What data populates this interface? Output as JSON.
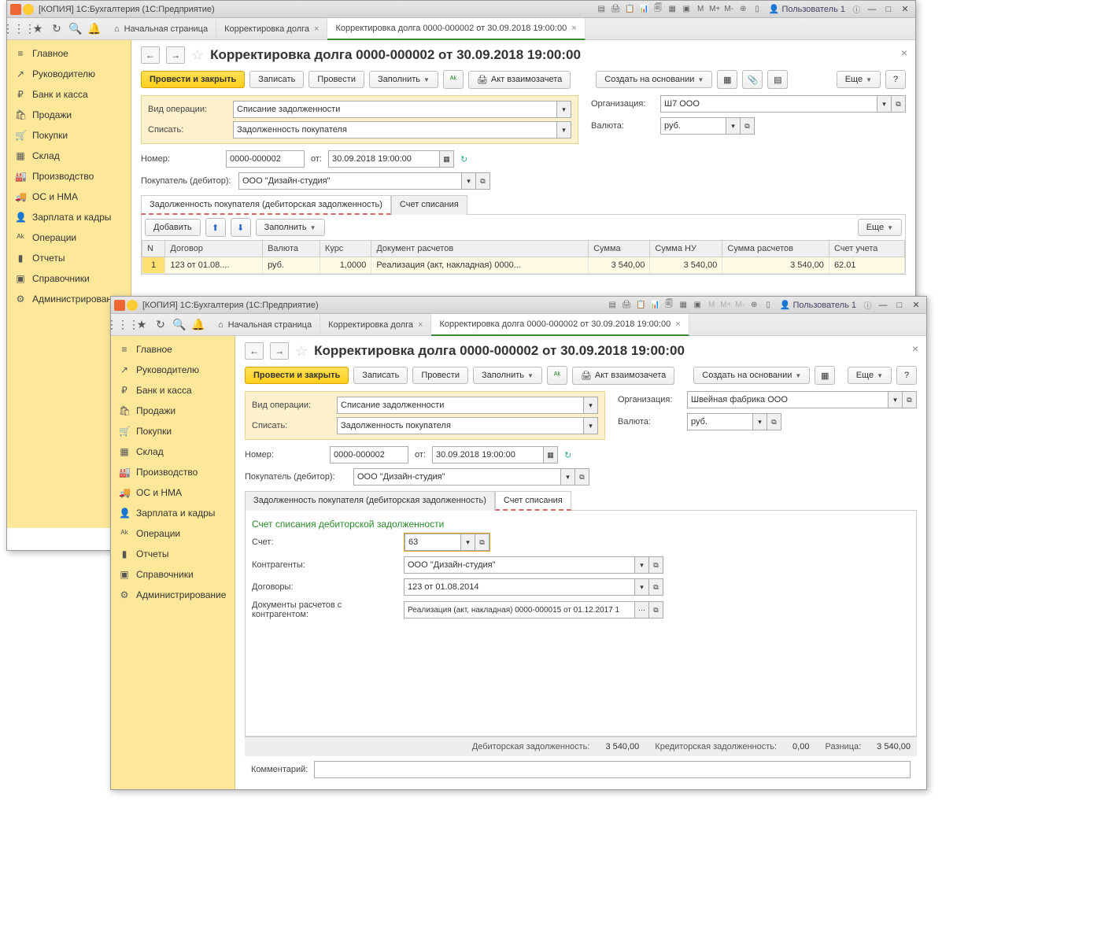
{
  "win1": {
    "title": "[КОПИЯ] 1С:Бухгалтерия  (1С:Предприятие)",
    "user": "Пользователь 1",
    "tb_letters": [
      "М",
      "М+",
      "М-"
    ],
    "tabs": [
      {
        "label": "Начальная страница"
      },
      {
        "label": "Корректировка долга"
      },
      {
        "label": "Корректировка долга 0000-000002 от 30.09.2018 19:00:00"
      }
    ],
    "sidebar": [
      {
        "icon": "≡",
        "label": "Главное"
      },
      {
        "icon": "↗",
        "label": "Руководителю"
      },
      {
        "icon": "₽",
        "label": "Банк и касса"
      },
      {
        "icon": "🛍",
        "label": "Продажи"
      },
      {
        "icon": "🛒",
        "label": "Покупки"
      },
      {
        "icon": "▦",
        "label": "Склад"
      },
      {
        "icon": "🏭",
        "label": "Производство"
      },
      {
        "icon": "🚚",
        "label": "ОС и НМА"
      },
      {
        "icon": "👤",
        "label": "Зарплата и кадры"
      },
      {
        "icon": "ᴬᵏ",
        "label": "Операции"
      },
      {
        "icon": "▮",
        "label": "Отчеты"
      },
      {
        "icon": "▣",
        "label": "Справочники"
      },
      {
        "icon": "⚙",
        "label": "Администрирование"
      }
    ],
    "doc_title": "Корректировка долга 0000-000002 от 30.09.2018 19:00:00",
    "buttons": {
      "post_close": "Провести и закрыть",
      "write": "Записать",
      "post": "Провести",
      "fill": "Заполнить",
      "act": "Акт взаимозачета",
      "create_based": "Создать на основании",
      "more": "Еще"
    },
    "fields": {
      "op_type_lbl": "Вид операции:",
      "op_type": "Списание задолженности",
      "writeoff_lbl": "Списать:",
      "writeoff": "Задолженность покупателя",
      "org_lbl": "Организация:",
      "org": "Ш7 ООО",
      "currency_lbl": "Валюта:",
      "currency": "руб.",
      "num_lbl": "Номер:",
      "num": "0000-000002",
      "date_lbl": "от:",
      "date": "30.09.2018 19:00:00",
      "buyer_lbl": "Покупатель (дебитор):",
      "buyer": "ООО \"Дизайн-студия\""
    },
    "subtabs": {
      "tab1": "Задолженность покупателя (дебиторская задолженность)",
      "tab2": "Счет списания"
    },
    "tbl_toolbar": {
      "add": "Добавить",
      "fill": "Заполнить",
      "more": "Еще"
    },
    "table": {
      "headers": [
        "N",
        "Договор",
        "Валюта",
        "Курс",
        "Документ расчетов",
        "Сумма",
        "Сумма НУ",
        "Сумма расчетов",
        "Счет учета"
      ],
      "row": {
        "n": "1",
        "contract": "123 от 01.08....",
        "currency": "руб.",
        "rate": "1,0000",
        "doc": "Реализация (акт, накладная) 0000...",
        "sum": "3 540,00",
        "sum_nu": "3 540,00",
        "sum_calc": "3 540,00",
        "account": "62.01"
      }
    }
  },
  "win2": {
    "title": "[КОПИЯ] 1С:Бухгалтерия  (1С:Предприятие)",
    "user": "Пользователь 1",
    "tb_letters": [
      "М",
      "М+",
      "М-"
    ],
    "tabs": [
      {
        "label": "Начальная страница"
      },
      {
        "label": "Корректировка долга"
      },
      {
        "label": "Корректировка долга 0000-000002 от 30.09.2018 19:00:00"
      }
    ],
    "doc_title": "Корректировка долга 0000-000002 от 30.09.2018 19:00:00",
    "fields": {
      "op_type": "Списание задолженности",
      "writeoff": "Задолженность покупателя",
      "org": "Швейная фабрика ООО",
      "currency": "руб.",
      "num": "0000-000002",
      "date": "30.09.2018 19:00:00",
      "buyer": "ООО \"Дизайн-студия\""
    },
    "section_title": "Счет списания дебиторской задолженности",
    "writeoff_fields": {
      "account_lbl": "Счет:",
      "account": "63",
      "contr_lbl": "Контрагенты:",
      "contr": "ООО \"Дизайн-студия\"",
      "contracts_lbl": "Договоры:",
      "contracts": "123 от 01.08.2014",
      "docs_lbl": "Документы расчетов с контрагентом:",
      "docs": "Реализация (акт, накладная) 0000-000015 от 01.12.2017 1"
    },
    "footer": {
      "deb_lbl": "Дебиторская задолженность:",
      "deb": "3 540,00",
      "cred_lbl": "Кредиторская задолженность:",
      "cred": "0,00",
      "diff_lbl": "Разница:",
      "diff": "3 540,00"
    },
    "comment_lbl": "Комментарий:"
  }
}
